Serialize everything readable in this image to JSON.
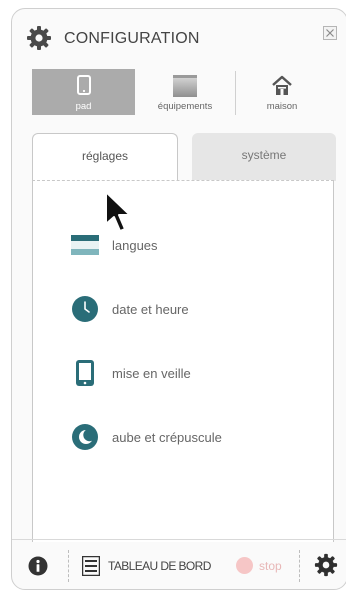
{
  "header": {
    "title": "CONFIGURATION",
    "gear_icon": "gear-icon",
    "close_icon": "close-icon"
  },
  "modes": [
    {
      "label": "pad",
      "icon": "tablet-icon",
      "active": true
    },
    {
      "label": "équipements",
      "icon": "device-icon",
      "active": false
    },
    {
      "label": "maison",
      "icon": "house-icon",
      "active": false
    }
  ],
  "tabs": [
    {
      "label": "réglages",
      "active": true
    },
    {
      "label": "système",
      "active": false
    }
  ],
  "settings_items": [
    {
      "label": "langues",
      "icon": "flag-icon"
    },
    {
      "label": "date et heure",
      "icon": "clock-icon"
    },
    {
      "label": "mise en veille",
      "icon": "tablet-icon"
    },
    {
      "label": "aube et crépuscule",
      "icon": "moon-icon"
    }
  ],
  "footer": {
    "info_icon": "info-icon",
    "dashboard_label": "TABLEAU DE BORD",
    "stop_label": "stop",
    "settings_icon": "gear-icon"
  },
  "colors": {
    "accent": "#2a6d78",
    "active_mode": "#ababab",
    "stop": "#f6c6c6"
  }
}
